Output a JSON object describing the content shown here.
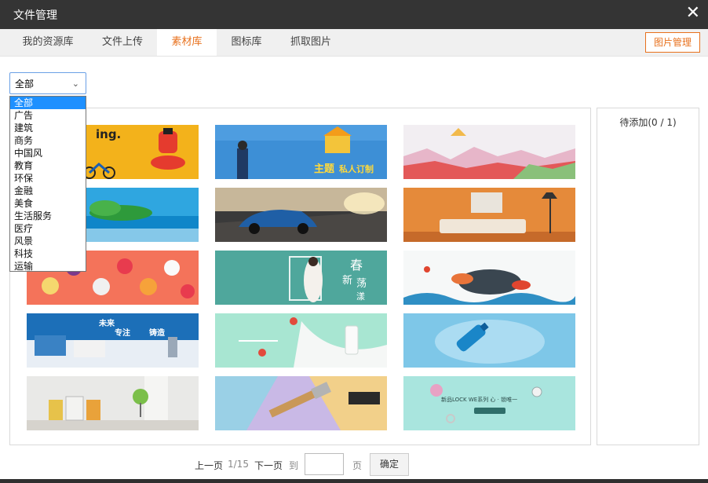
{
  "window": {
    "title": "文件管理",
    "close_label": "✕"
  },
  "tabs": [
    {
      "label": "我的资源库"
    },
    {
      "label": "文件上传"
    },
    {
      "label": "素材库"
    },
    {
      "label": "图标库"
    },
    {
      "label": "抓取图片"
    }
  ],
  "active_tab": "素材库",
  "image_manage_label": "图片管理",
  "category": {
    "selected": "全部",
    "options": [
      "全部",
      "广告",
      "建筑",
      "商务",
      "中国风",
      "教育",
      "环保",
      "金融",
      "美食",
      "生活服务",
      "医疗",
      "风景",
      "科技",
      "运输"
    ]
  },
  "pending": {
    "text": "待添加(0 / 1)"
  },
  "thumbnails": [
    {
      "name": "ad-cycling",
      "text": "ing."
    },
    {
      "name": "theme-custom",
      "text": "主题",
      "text2": "私人订制"
    },
    {
      "name": "lowpoly-cheering",
      "text": ""
    },
    {
      "name": "tropical-island",
      "text": ""
    },
    {
      "name": "blue-car",
      "text": ""
    },
    {
      "name": "living-room-mockup",
      "text": ""
    },
    {
      "name": "desserts",
      "text": ""
    },
    {
      "name": "spring-fashion",
      "text": "春",
      "text2": "新",
      "text3": "荡",
      "text4": "漾"
    },
    {
      "name": "seafood",
      "text": ""
    },
    {
      "name": "business-focus",
      "text": "未来",
      "text2": "专注",
      "text3": "铸造"
    },
    {
      "name": "milk-splash",
      "text": ""
    },
    {
      "name": "water-bottle",
      "text": ""
    },
    {
      "name": "paint-cans",
      "text": ""
    },
    {
      "name": "paint-brushes",
      "text": ""
    },
    {
      "name": "mint-accessories",
      "text": "新品LOCK  WE系列  心 · 锁唯一"
    }
  ],
  "pager": {
    "prev": "上一页",
    "page_info": "1/15",
    "next": "下一页",
    "goto": "到",
    "page_unit": "页",
    "confirm": "确定",
    "input_value": ""
  }
}
